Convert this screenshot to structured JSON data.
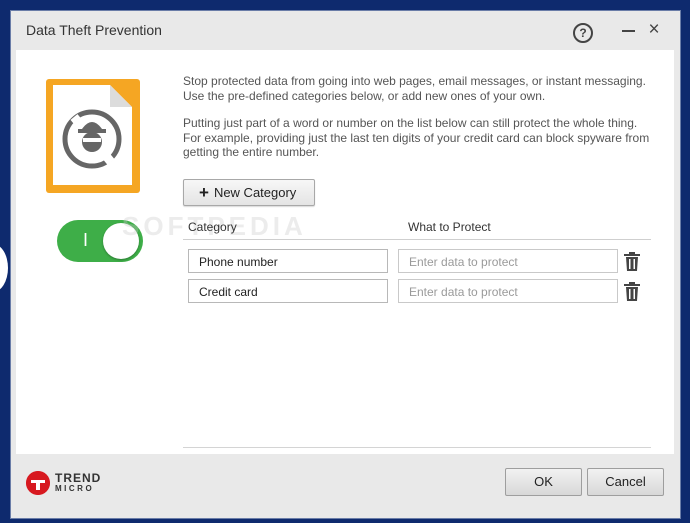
{
  "window": {
    "title": "Data Theft Prevention",
    "help_glyph": "?",
    "minimize_glyph": "",
    "close_glyph": "×"
  },
  "feature": {
    "icon": "spy-document-icon",
    "toggle_label": "I",
    "enabled": true
  },
  "description": {
    "paragraph1": "Stop protected data from going into web pages, email messages, or instant messaging.\nUse the pre-defined categories below, or add new ones of your own.",
    "paragraph2": "Putting just part of a word or number on the list below can still protect the whole thing.\nFor example, providing just the last ten digits of your credit card can block spyware from\ngetting the entire number."
  },
  "toolbar": {
    "new_category_label": "New Category"
  },
  "table": {
    "col_category": "Category",
    "col_protect": "What to Protect",
    "rows": [
      {
        "category": "Phone number",
        "protect_placeholder": "Enter data to protect"
      },
      {
        "category": "Credit card",
        "protect_placeholder": "Enter data to protect"
      }
    ]
  },
  "footer": {
    "logo_line1": "TREND",
    "logo_line2": "MICRO",
    "ok_label": "OK",
    "cancel_label": "Cancel"
  },
  "watermark": "SOFTPEDIA",
  "colors": {
    "toggle_on": "#3eae48",
    "icon_frame": "#f5a623",
    "brand_red": "#d71920",
    "desktop": "#0e2a6e"
  }
}
